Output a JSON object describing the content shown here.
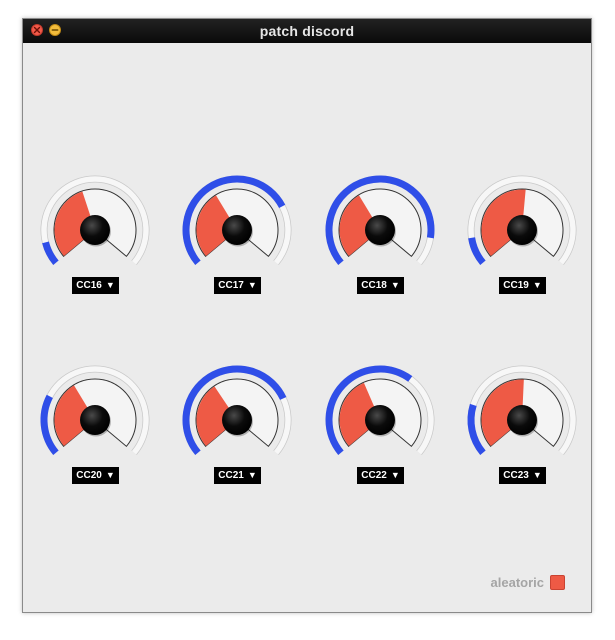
{
  "window": {
    "title": "patch discord"
  },
  "colors": {
    "blue": "#2f4ee8",
    "red": "#ee5a45",
    "knob": "#0b0b0b"
  },
  "dials": [
    {
      "label": "CC16",
      "blue_fraction": 0.1,
      "red_fraction": 0.43
    },
    {
      "label": "CC17",
      "blue_fraction": 0.74,
      "red_fraction": 0.38
    },
    {
      "label": "CC18",
      "blue_fraction": 0.88,
      "red_fraction": 0.38
    },
    {
      "label": "CC19",
      "blue_fraction": 0.12,
      "red_fraction": 0.52
    },
    {
      "label": "CC20",
      "blue_fraction": 0.26,
      "red_fraction": 0.38
    },
    {
      "label": "CC21",
      "blue_fraction": 0.75,
      "red_fraction": 0.37
    },
    {
      "label": "CC22",
      "blue_fraction": 0.64,
      "red_fraction": 0.41
    },
    {
      "label": "CC23",
      "blue_fraction": 0.22,
      "red_fraction": 0.51
    }
  ],
  "aleatoric": {
    "label": "aleatoric"
  }
}
